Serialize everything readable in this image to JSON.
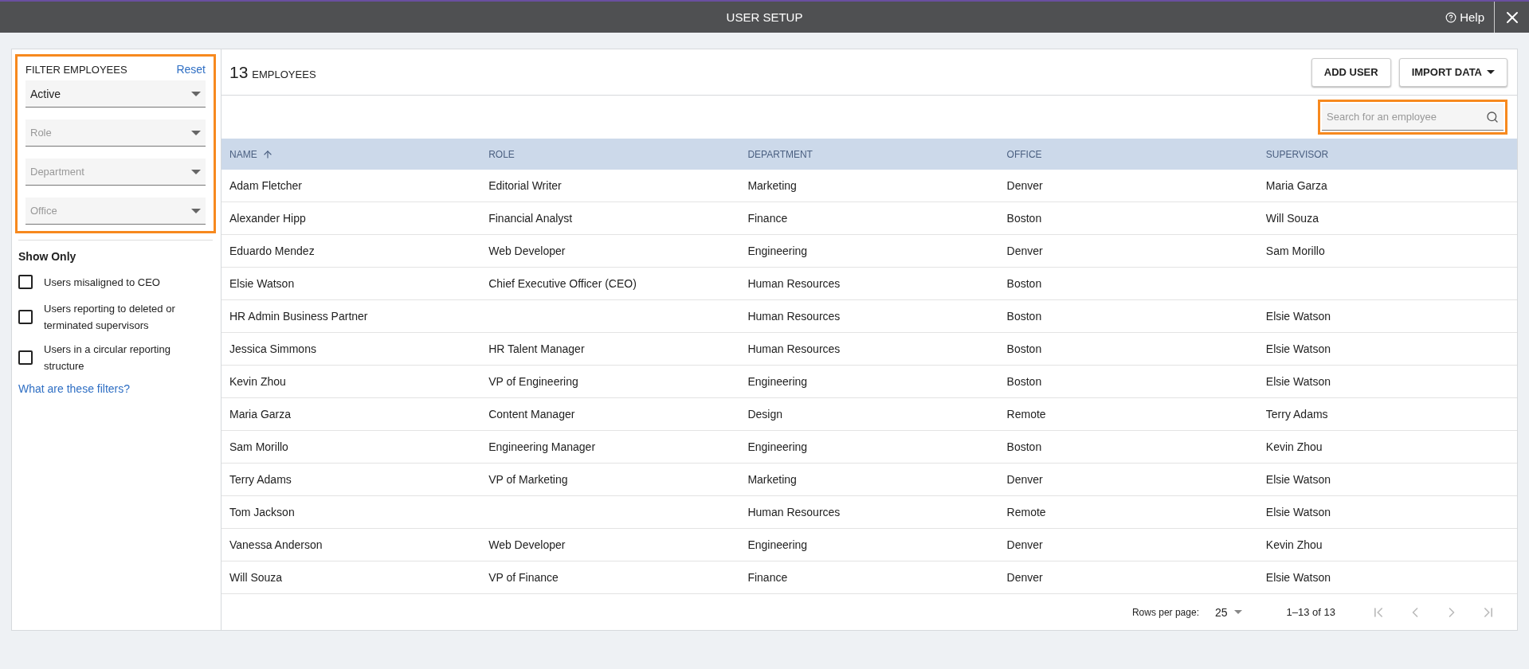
{
  "window": {
    "title": "USER SETUP",
    "help": "Help"
  },
  "filters": {
    "title": "FILTER EMPLOYEES",
    "reset": "Reset",
    "highlighted": true,
    "selects": [
      {
        "value": "Active"
      },
      {
        "placeholder": "Role"
      },
      {
        "placeholder": "Department"
      },
      {
        "placeholder": "Office"
      }
    ]
  },
  "show_only": {
    "title": "Show Only",
    "options": [
      {
        "label": "Users misaligned to CEO",
        "checked": false
      },
      {
        "label": "Users reporting to deleted or terminated supervisors",
        "checked": false
      },
      {
        "label": "Users in a circular reporting structure",
        "checked": false
      }
    ],
    "link": "What are these filters?"
  },
  "header": {
    "count": "13",
    "count_label": "EMPLOYEES",
    "buttons": [
      {
        "label": "ADD USER",
        "kind": "plain"
      },
      {
        "label": "IMPORT DATA",
        "kind": "dropdown"
      }
    ]
  },
  "search": {
    "placeholder": "Search for an employee",
    "highlighted": true
  },
  "table": {
    "columns": [
      {
        "label": "NAME",
        "sorted": true
      },
      {
        "label": "ROLE",
        "sorted": false
      },
      {
        "label": "DEPARTMENT",
        "sorted": false
      },
      {
        "label": "OFFICE",
        "sorted": false
      },
      {
        "label": "SUPERVISOR",
        "sorted": false
      }
    ],
    "rows": [
      [
        "Adam Fletcher",
        "Editorial Writer",
        "Marketing",
        "Denver",
        "Maria Garza"
      ],
      [
        "Alexander Hipp",
        "Financial Analyst",
        "Finance",
        "Boston",
        "Will Souza"
      ],
      [
        "Eduardo Mendez",
        "Web Developer",
        "Engineering",
        "Denver",
        "Sam Morillo"
      ],
      [
        "Elsie Watson",
        "Chief Executive Officer (CEO)",
        "Human Resources",
        "Boston",
        ""
      ],
      [
        "HR Admin Business Partner",
        "",
        "Human Resources",
        "Boston",
        "Elsie Watson"
      ],
      [
        "Jessica Simmons",
        "HR Talent Manager",
        "Human Resources",
        "Boston",
        "Elsie Watson"
      ],
      [
        "Kevin Zhou",
        "VP of Engineering",
        "Engineering",
        "Boston",
        "Elsie Watson"
      ],
      [
        "Maria Garza",
        "Content Manager",
        "Design",
        "Remote",
        "Terry Adams"
      ],
      [
        "Sam Morillo",
        "Engineering Manager",
        "Engineering",
        "Boston",
        "Kevin Zhou"
      ],
      [
        "Terry Adams",
        "VP of Marketing",
        "Marketing",
        "Denver",
        "Elsie Watson"
      ],
      [
        "Tom Jackson",
        "",
        "Human Resources",
        "Remote",
        "Elsie Watson"
      ],
      [
        "Vanessa Anderson",
        "Web Developer",
        "Engineering",
        "Denver",
        "Kevin Zhou"
      ],
      [
        "Will Souza",
        "VP of Finance",
        "Finance",
        "Denver",
        "Elsie Watson"
      ]
    ]
  },
  "pagination": {
    "rows_label": "Rows per page:",
    "rows_value": "25",
    "range": "1–13 of 13"
  }
}
